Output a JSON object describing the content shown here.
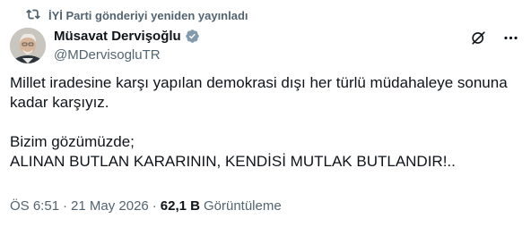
{
  "repost": {
    "icon": "repost-icon",
    "text": "İYİ Parti gönderiyi yeniden yayınladı"
  },
  "author": {
    "display_name": "Müsavat Dervişoğlu",
    "handle": "@MDervisogluTR",
    "verified_icon": "verified-badge-icon",
    "verified_color": "#829aab",
    "avatar_icon": "profile-photo"
  },
  "actions": {
    "grok_icon": "grok-icon",
    "more_icon": "more-icon"
  },
  "tweet": {
    "paragraph1": "Millet iradesine karşı yapılan demokrasi dışı her türlü müdahaleye sonuna kadar karşıyız.",
    "line2": "Bizim gözümüzde;",
    "line3": "ALINAN BUTLAN KARARININ, KENDİSİ MUTLAK BUTLANDIR!.."
  },
  "meta": {
    "time": "ÖS 6:51",
    "separator": "·",
    "date": "21 May 2026",
    "views_count": "62,1 B",
    "views_label": "Görüntüleme"
  },
  "colors": {
    "text_primary": "#0f1419",
    "text_secondary": "#536471",
    "background": "#ffffff"
  }
}
